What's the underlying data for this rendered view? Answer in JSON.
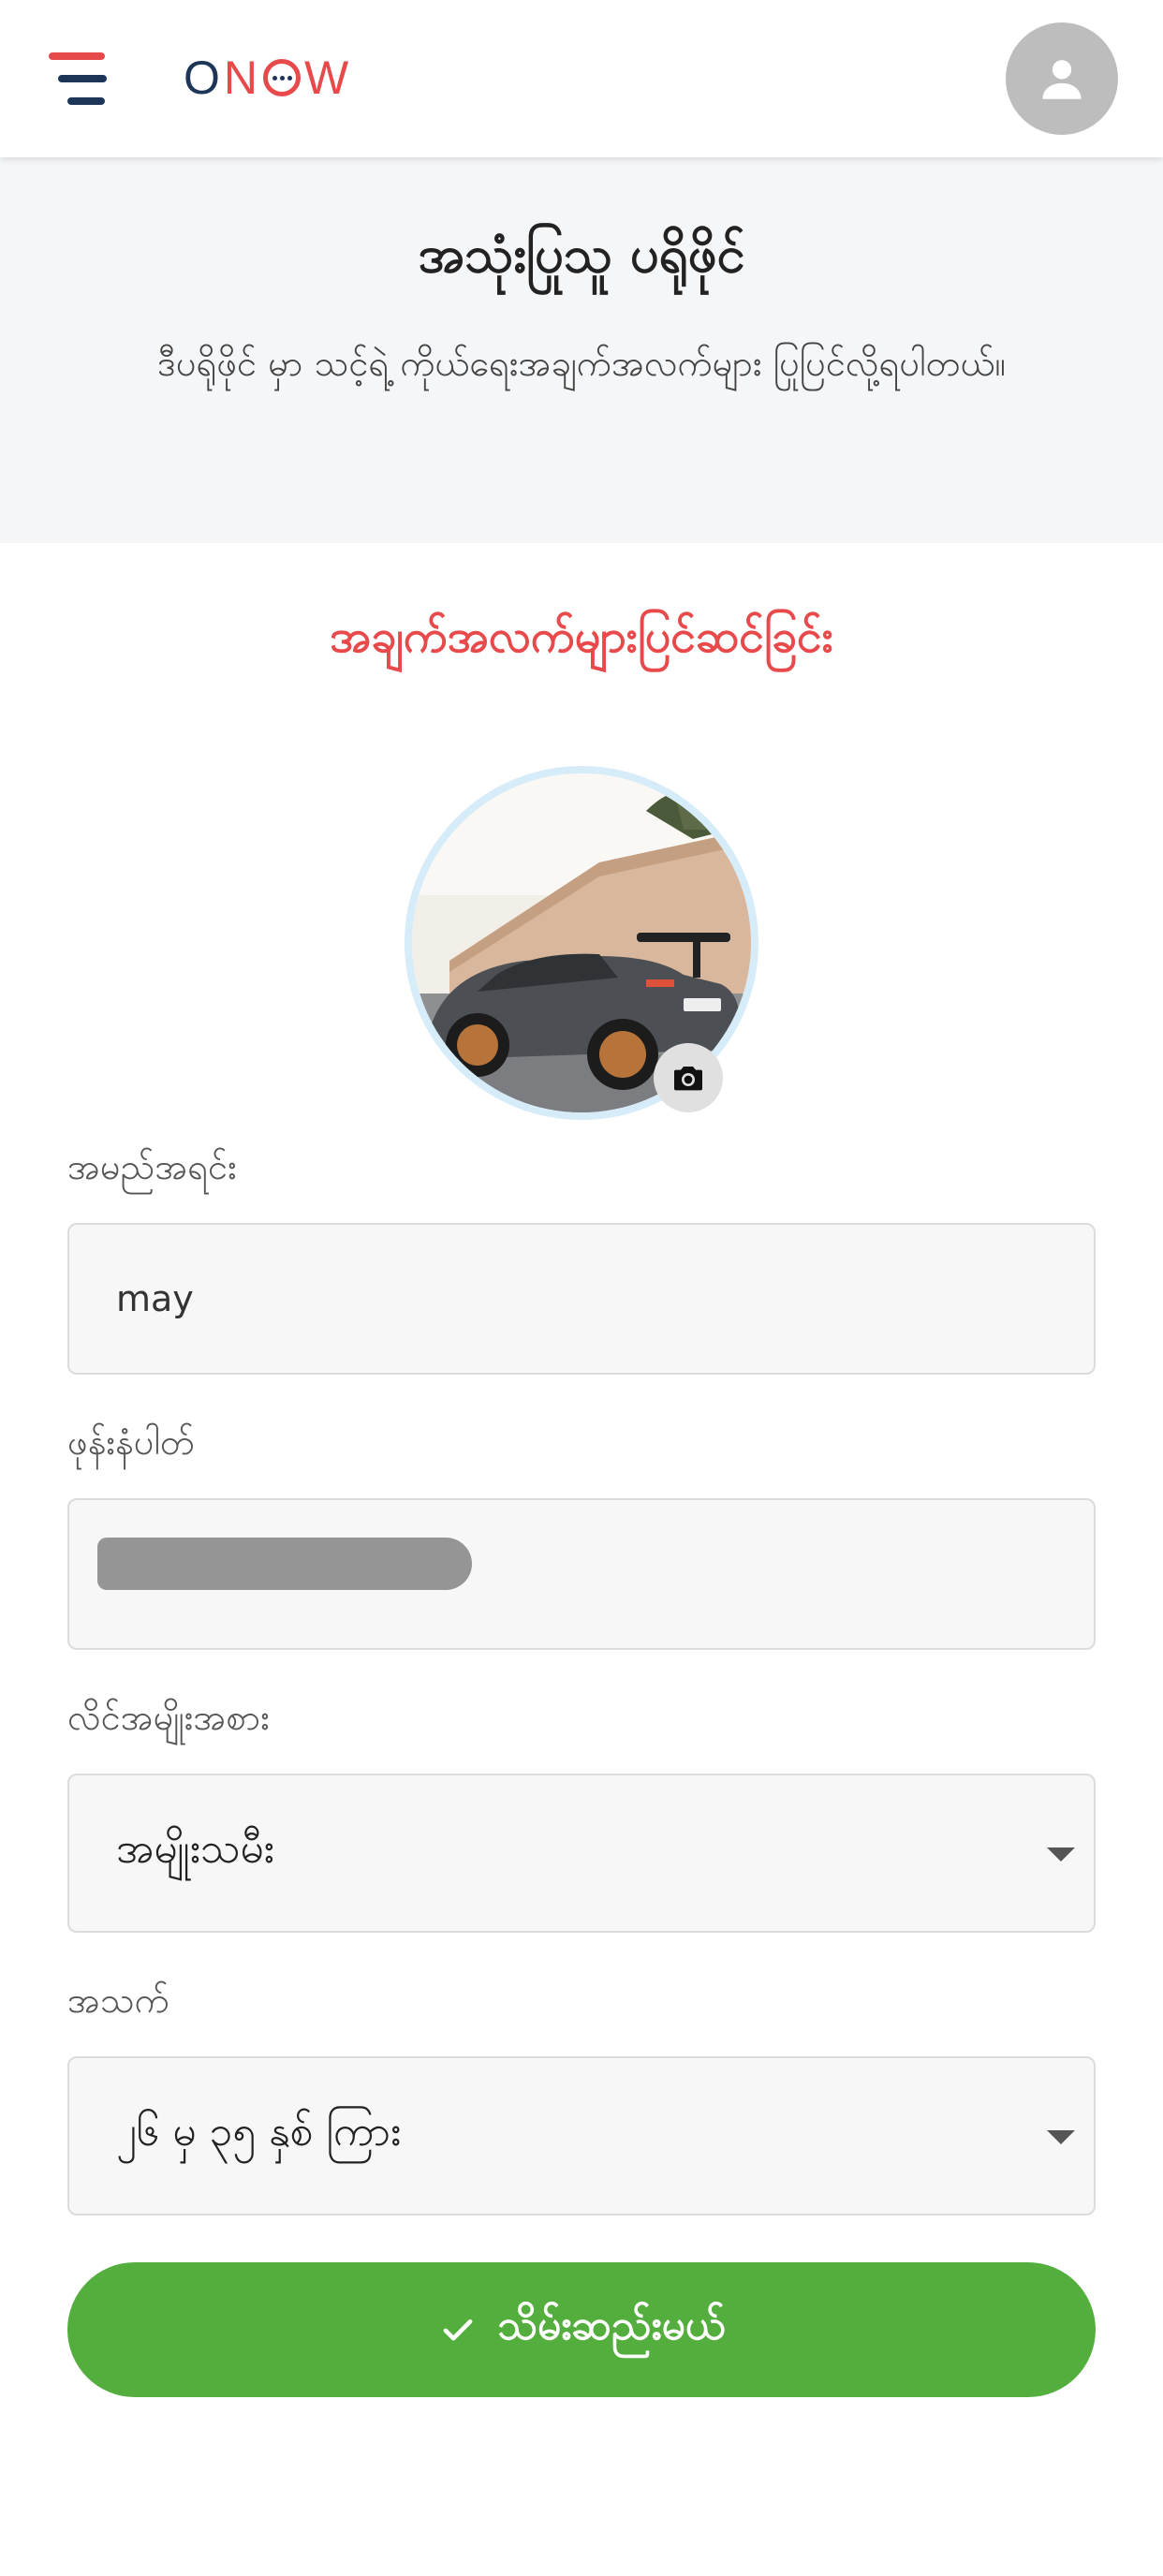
{
  "header": {
    "logo": {
      "letters": [
        "O",
        "N",
        "",
        "W"
      ]
    },
    "menu_icon": "hamburger-menu-icon",
    "profile_icon": "person-avatar-icon"
  },
  "hero": {
    "title": "အသုံးပြုသူ ပရိုဖိုင်",
    "subtitle": "ဒီပရိုဖိုင် မှာ သင့်ရဲ့ ကိုယ်ရေးအချက်အလက်များ ပြုပြင်လို့ရပါတယ်။"
  },
  "edit_section": {
    "title": "အချက်အလက်များပြင်ဆင်ခြင်း",
    "photo_icon": "camera-icon"
  },
  "form": {
    "name": {
      "label": "အမည်အရင်း",
      "value": "may"
    },
    "phone": {
      "label": "ဖုန်းနံပါတ်",
      "value": ""
    },
    "gender": {
      "label": "လိင်အမျိုးအစား",
      "value": "အမျိုးသမီး"
    },
    "age": {
      "label": "အသက်",
      "value": "၂၆ မှ ၃၅ နှစ် ကြား"
    }
  },
  "save_button": {
    "label": "သိမ်းဆည်းမယ်",
    "icon": "check-icon"
  },
  "colors": {
    "accent_red": "#e8494b",
    "navy": "#1d3557",
    "save_green": "#53ae3d",
    "hero_bg": "#f5f6f8"
  }
}
